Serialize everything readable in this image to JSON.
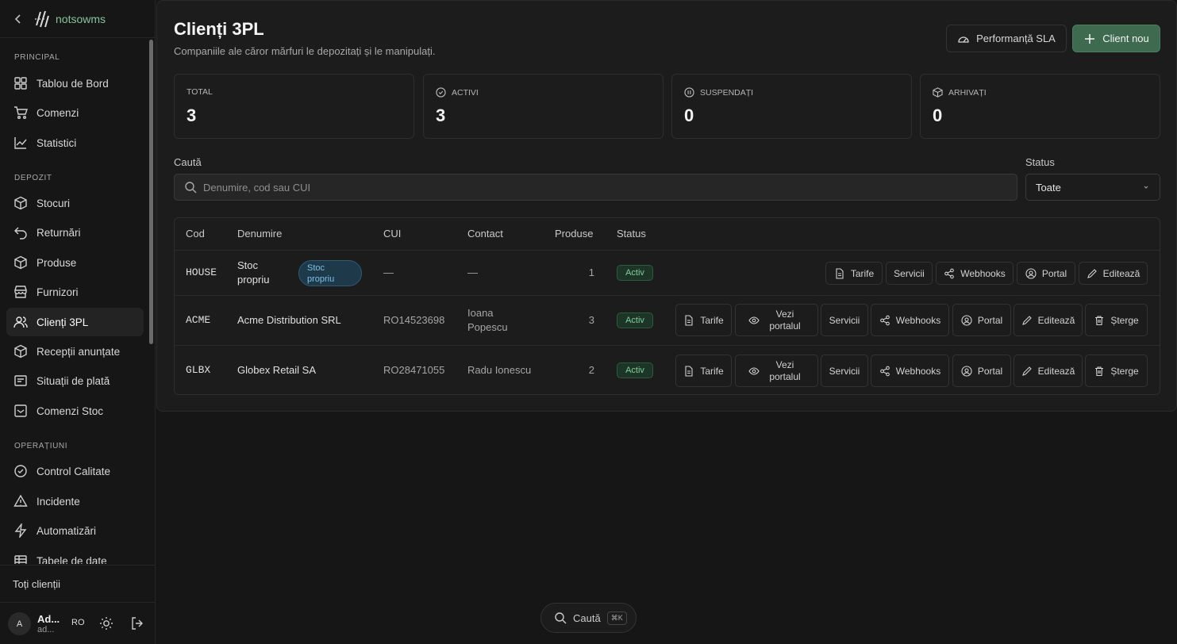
{
  "sidebar": {
    "brand": "notsowms",
    "sections": {
      "principal": "PRINCIPAL",
      "depozit": "DEPOZIT",
      "operatiuni": "OPERAȚIUNI"
    },
    "items": {
      "dashboard": "Tablou de Bord",
      "orders": "Comenzi",
      "stats": "Statistici",
      "stock": "Stocuri",
      "returns": "Returnări",
      "products": "Produse",
      "suppliers": "Furnizori",
      "clients": "Clienți 3PL",
      "receptions": "Recepții anunțate",
      "payments": "Situații de plată",
      "stock_orders": "Comenzi Stoc",
      "qc": "Control Calitate",
      "incidents": "Incidente",
      "automations": "Automatizări",
      "tables": "Tabele de date"
    },
    "all_clients": "Toți clienții",
    "user": {
      "initial": "A",
      "name": "Ad...",
      "email": "ad...",
      "lang": "RO"
    }
  },
  "page": {
    "title": "Clienți 3PL",
    "subtitle": "Companiile ale căror mărfuri le depozitați și le manipulați.",
    "sla_button": "Performanță SLA",
    "new_client_button": "Client nou"
  },
  "stats": {
    "total": {
      "label": "TOTAL",
      "value": "3"
    },
    "active": {
      "label": "ACTIVI",
      "value": "3"
    },
    "suspended": {
      "label": "SUSPENDAȚI",
      "value": "0"
    },
    "archived": {
      "label": "ARHIVAȚI",
      "value": "0"
    }
  },
  "filters": {
    "search_label": "Caută",
    "search_placeholder": "Denumire, cod sau CUI",
    "status_label": "Status",
    "status_value": "Toate"
  },
  "table": {
    "headers": {
      "code": "Cod",
      "name": "Denumire",
      "cui": "CUI",
      "contact": "Contact",
      "products": "Produse",
      "status": "Status"
    },
    "rows": [
      {
        "code": "HOUSE",
        "name": "Stoc propriu",
        "badge": "Stoc propriu",
        "cui": "—",
        "contact": "—",
        "products": "1",
        "status": "Activ"
      },
      {
        "code": "ACME",
        "name": "Acme Distribution SRL",
        "cui": "RO14523698",
        "contact": "Ioana Popescu",
        "products": "3",
        "status": "Activ"
      },
      {
        "code": "GLBX",
        "name": "Globex Retail SA",
        "cui": "RO28471055",
        "contact": "Radu Ionescu",
        "products": "2",
        "status": "Activ"
      }
    ],
    "actions": {
      "rates": "Tarife",
      "view_portal": "Vezi portalul",
      "services": "Servicii",
      "webhooks": "Webhooks",
      "portal": "Portal",
      "edit": "Editează",
      "delete": "Șterge"
    }
  },
  "command": {
    "label": "Caută",
    "shortcut": "⌘K"
  }
}
